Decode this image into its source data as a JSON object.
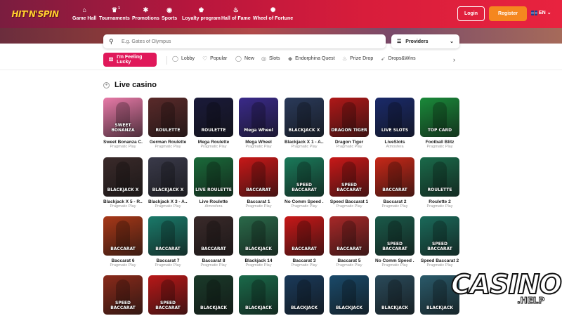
{
  "header": {
    "logo": "HIT'N'SPIN",
    "nav": [
      {
        "label": "Game Hall",
        "icon": "home-icon",
        "glyph": "⌂"
      },
      {
        "label": "Tournaments",
        "icon": "trophy-icon",
        "glyph": "♛",
        "badge": "1"
      },
      {
        "label": "Promotions",
        "icon": "gift-icon",
        "glyph": "✱"
      },
      {
        "label": "Sports",
        "icon": "soccer-ball-icon",
        "glyph": "◉"
      },
      {
        "label": "Loyalty program",
        "icon": "crown-icon",
        "glyph": "♚"
      },
      {
        "label": "Hall of Fame",
        "icon": "flame-icon",
        "glyph": "♨"
      },
      {
        "label": "Wheel of Fortune",
        "icon": "wheel-icon",
        "glyph": "✺"
      }
    ],
    "login_label": "Login",
    "register_label": "Register",
    "language": "EN"
  },
  "search": {
    "placeholder": "E.g. Gates of Olympus",
    "providers_label": "Providers"
  },
  "categories": {
    "feeling_lucky": "I'm Feeling Lucky",
    "items": [
      {
        "label": "Lobby",
        "icon": "lobby-icon",
        "glyph": "◯"
      },
      {
        "label": "Popular",
        "icon": "heart-icon",
        "glyph": "♡"
      },
      {
        "label": "New",
        "icon": "new-icon",
        "glyph": "◯"
      },
      {
        "label": "Slots",
        "icon": "slots-icon",
        "glyph": "◎"
      },
      {
        "label": "Endorphina Quest",
        "icon": "endorphina-icon",
        "glyph": "◆"
      },
      {
        "label": "Prize Drop",
        "icon": "prize-drop-icon",
        "glyph": "♨"
      },
      {
        "label": "Drops&Wins",
        "icon": "drops-wins-icon",
        "glyph": "➹"
      }
    ]
  },
  "section": {
    "title": "Live casino"
  },
  "games": [
    {
      "name": "Sweet Bonanza C...",
      "provider": "Pragmatic Play",
      "art": "SWEET BONANZA",
      "bg": "#e87aa8"
    },
    {
      "name": "German Roulette",
      "provider": "Pragmatic Play",
      "art": "ROULETTE",
      "bg": "#5a2a2a"
    },
    {
      "name": "Mega Roulette",
      "provider": "Pragmatic Play",
      "art": "ROULETTE",
      "bg": "#1a1a3a"
    },
    {
      "name": "Mega Wheel",
      "provider": "Pragmatic Play",
      "art": "Mega Wheel",
      "bg": "#3a2a8a"
    },
    {
      "name": "Blackjack X 1 - A...",
      "provider": "Pragmatic Play",
      "art": "BLACKJACK X",
      "bg": "#2a3a5a"
    },
    {
      "name": "Dragon Tiger",
      "provider": "Pragmatic Play",
      "art": "DRAGON TIGER",
      "bg": "#b01818"
    },
    {
      "name": "LiveSlots",
      "provider": "Atmosfera",
      "art": "LIVE SLOTS",
      "bg": "#1a2a6a"
    },
    {
      "name": "Football Blitz",
      "provider": "Pragmatic Play",
      "art": "TOP CARD",
      "bg": "#1a8a3a"
    },
    {
      "name": "Blackjack X 5 - R...",
      "provider": "Pragmatic Play",
      "art": "BLACKJACK X",
      "bg": "#3a2a2a"
    },
    {
      "name": "Blackjack X 3 - A...",
      "provider": "Pragmatic Play",
      "art": "BLACKJACK X",
      "bg": "#3a3a4a"
    },
    {
      "name": "Live Roulette",
      "provider": "Atmosfera",
      "art": "LIVE ROULETTE",
      "bg": "#1a6a3a"
    },
    {
      "name": "Baccarat 1",
      "provider": "Pragmatic Play",
      "art": "BACCARAT",
      "bg": "#c81818"
    },
    {
      "name": "No Comm Speed ...",
      "provider": "Pragmatic Play",
      "art": "SPEED BACCARAT",
      "bg": "#1a7a5a"
    },
    {
      "name": "Speed Baccarat 1",
      "provider": "Pragmatic Play",
      "art": "SPEED BACCARAT",
      "bg": "#c81818"
    },
    {
      "name": "Baccarat 2",
      "provider": "Pragmatic Play",
      "art": "BACCARAT",
      "bg": "#c82818"
    },
    {
      "name": "Roulette 2",
      "provider": "Pragmatic Play",
      "art": "ROULETTE",
      "bg": "#1a6a4a"
    },
    {
      "name": "Baccarat 6",
      "provider": "Pragmatic Play",
      "art": "BACCARAT",
      "bg": "#a83818"
    },
    {
      "name": "Baccarat 7",
      "provider": "Pragmatic Play",
      "art": "BACCARAT",
      "bg": "#1a7a6a"
    },
    {
      "name": "Baccarat 8",
      "provider": "Pragmatic Play",
      "art": "BACCARAT",
      "bg": "#3a2a2a"
    },
    {
      "name": "Blackjack 14",
      "provider": "Pragmatic Play",
      "art": "BLACKJACK",
      "bg": "#2a6a4a"
    },
    {
      "name": "Baccarat 3",
      "provider": "Pragmatic Play",
      "art": "BACCARAT",
      "bg": "#c81818"
    },
    {
      "name": "Baccarat 5",
      "provider": "Pragmatic Play",
      "art": "BACCARAT",
      "bg": "#a82828"
    },
    {
      "name": "No Comm Speed ...",
      "provider": "Pragmatic Play",
      "art": "SPEED BACCARAT",
      "bg": "#1a5a4a"
    },
    {
      "name": "Speed Baccarat 2",
      "provider": "Pragmatic Play",
      "art": "SPEED BACCARAT",
      "bg": "#1a6a5a"
    },
    {
      "name": "",
      "provider": "",
      "art": "SPEED BACCARAT",
      "bg": "#8a2a1a"
    },
    {
      "name": "",
      "provider": "",
      "art": "SPEED BACCARAT",
      "bg": "#b81818"
    },
    {
      "name": "",
      "provider": "",
      "art": "BLACKJACK",
      "bg": "#1a3a2a"
    },
    {
      "name": "",
      "provider": "",
      "art": "BLACKJACK",
      "bg": "#1a6a4a"
    },
    {
      "name": "",
      "provider": "",
      "art": "BLACKJACK",
      "bg": "#1a3a5a"
    },
    {
      "name": "",
      "provider": "",
      "art": "BLACKJACK",
      "bg": "#1a4a6a"
    },
    {
      "name": "",
      "provider": "",
      "art": "BLACKJACK",
      "bg": "#2a4a5a"
    },
    {
      "name": "",
      "provider": "",
      "art": "BLACKJACK",
      "bg": "#2a5a6a"
    }
  ],
  "watermark": {
    "text": "CASINO!",
    "sub": ".HELP"
  },
  "colors": {
    "brand_pink": "#e0185a",
    "register_orange": "#f5871f",
    "header_red": "#d81d3b"
  }
}
